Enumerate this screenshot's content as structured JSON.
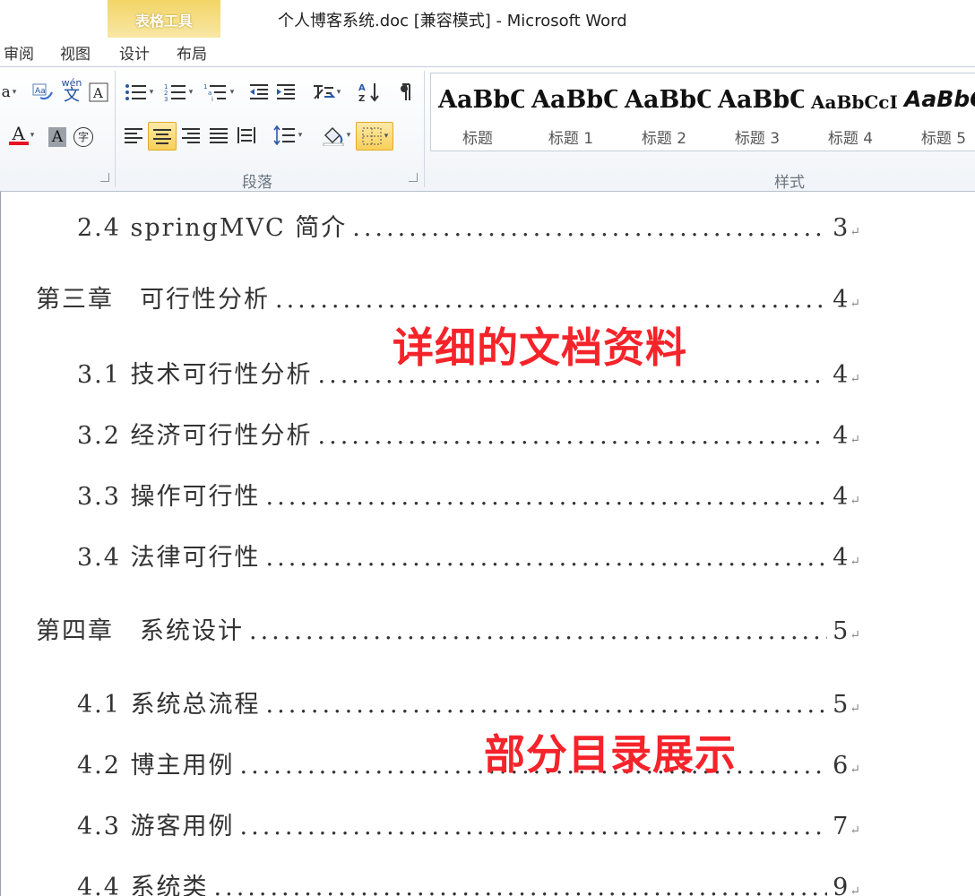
{
  "window": {
    "title": "个人博客系统.doc [兼容模式] - Microsoft Word"
  },
  "contextual_tab": {
    "header": "表格工具"
  },
  "tabs": [
    {
      "label": "审阅"
    },
    {
      "label": "视图"
    },
    {
      "label": "设计"
    },
    {
      "label": "布局"
    }
  ],
  "ribbon": {
    "font_group": {
      "font_size_fragment": "a",
      "phonetic_glyph": "wén",
      "phonetic_char": "文",
      "font_color_glyph": "A",
      "shading_glyph": "A",
      "enclose_glyph": "字",
      "accent_color": "#e81123"
    },
    "paragraph_group": {
      "label": "段落"
    },
    "styles_group": {
      "label": "样式",
      "items": [
        {
          "sample": "AaBbC",
          "name": "标题"
        },
        {
          "sample": "AaBbC",
          "name": "标题 1"
        },
        {
          "sample": "AaBbC",
          "name": "标题 2"
        },
        {
          "sample": "AaBbC",
          "name": "标题 3"
        },
        {
          "sample": "AaBbCcI",
          "name": "标题 4"
        },
        {
          "sample": "AaBbC",
          "name": "标题 5"
        }
      ]
    }
  },
  "toc": [
    {
      "text": "2.4 springMVC 简介",
      "page": "3"
    },
    {
      "text": "第三章　可行性分析",
      "page": "4"
    },
    {
      "text": "3.1 技术可行性分析",
      "page": "4"
    },
    {
      "text": "3.2 经济可行性分析",
      "page": "4"
    },
    {
      "text": "3.3 操作可行性",
      "page": "4"
    },
    {
      "text": "3.4 法律可行性",
      "page": "4"
    },
    {
      "text": "第四章　系统设计",
      "page": "5"
    },
    {
      "text": "4.1 系统总流程",
      "page": "5"
    },
    {
      "text": "4.2 博主用例",
      "page": "6"
    },
    {
      "text": "4.3 游客用例",
      "page": "7"
    },
    {
      "text": "4.4 系统类",
      "page": "9"
    }
  ],
  "paragraph_mark": "↵",
  "overlays": {
    "top": "详细的文档资料",
    "bottom": "部分目录展示",
    "color": "#f5232a"
  }
}
